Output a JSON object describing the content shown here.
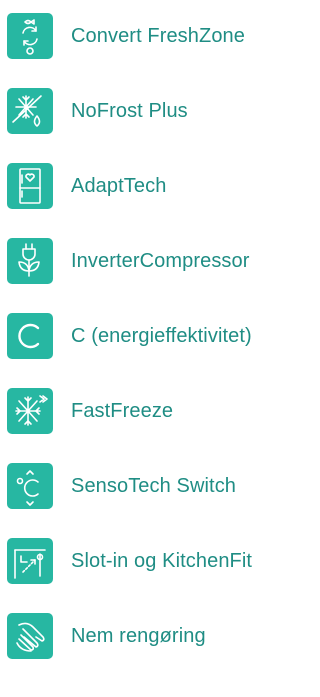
{
  "accent_color": "#27b7a2",
  "text_color": "#1f8d84",
  "features": [
    {
      "icon": "convert-freshzone-icon",
      "label": "Convert FreshZone"
    },
    {
      "icon": "nofrost-plus-icon",
      "label": "NoFrost Plus"
    },
    {
      "icon": "adapttech-icon",
      "label": "AdaptTech"
    },
    {
      "icon": "inverter-compressor-icon",
      "label": "InverterCompressor"
    },
    {
      "icon": "energy-class-c-icon",
      "label": "C (energieffektivitet)"
    },
    {
      "icon": "fastfreeze-icon",
      "label": "FastFreeze"
    },
    {
      "icon": "sensotech-switch-icon",
      "label": "SensoTech Switch"
    },
    {
      "icon": "slot-in-kitchenfit-icon",
      "label": "Slot-in og KitchenFit"
    },
    {
      "icon": "easy-cleaning-icon",
      "label": "Nem rengøring"
    }
  ]
}
